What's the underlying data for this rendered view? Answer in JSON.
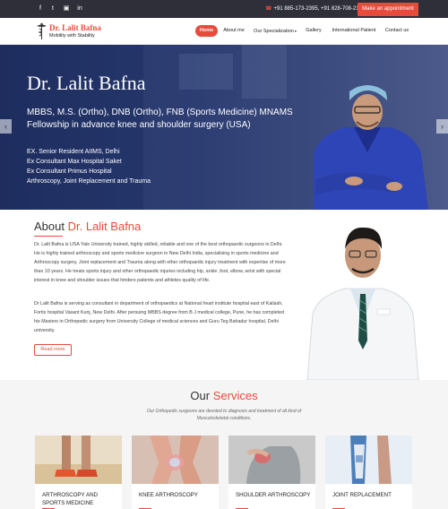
{
  "topbar": {
    "social": [
      "facebook-icon",
      "twitter-icon",
      "instagram-icon",
      "linkedin-icon"
    ],
    "phone": "+91 885-173-2395, +91 828-708-2133",
    "appointment_button": "Make an appointment"
  },
  "brand": {
    "name": "Dr. Lalit Bafna",
    "tagline": "Mobility with Stability"
  },
  "nav": {
    "items": [
      "Home",
      "About me",
      "Our Specialization",
      "Gallery",
      "International Patient",
      "Contact us"
    ],
    "active": "Home"
  },
  "hero": {
    "title": "Dr. Lalit Bafna",
    "subtitle_line1": "MBBS, M.S. (Ortho), DNB (Ortho), FNB (Sports Medicine) MNAMS",
    "subtitle_line2": "Fellowship in advance knee and shoulder surgery (USA)",
    "list": [
      "EX. Senior Resident AIIMS, Delhi",
      "Ex Consultant Max Hospital Saket",
      "Ex Consultant Primus Hospital",
      "Arthroscopy, Joint Replacement and Trauma"
    ]
  },
  "about": {
    "heading_prefix": "About",
    "heading_name": "Dr. Lalit Bafna",
    "para1": "Dr. Lalit Bafna is USA Yale University trained, highly skilled, reliable and one of the best orthopaedic surgeons in Delhi. He is highly trained arthroscopy and sports medicine surgeon in New Delhi India, specialising in sports medicine and Arthroscopy surgery, Joint replacement and Trauma along with other orthopaedic injury treatment with expertise of more than 10 years. He treats sports injury and other orthopaedic injuries including hip, ankle ,foot, elbow, wrist with special interest in knee and shoulder issues that hinders patients and athletes quality of life.",
    "para2": "Dr Lalit Bafna is serving as consultant in department of orthopaedics at National heart institute hospital east of Kailash, Fortis hospital Vasant Kunj, New Delhi. After persuing MBBS degree from B J medical college, Pune, he has completed his Masters in Orthopedic surgery from University College of medical sciences and Guru Teg Bahadur hospital, Delhi university.",
    "read_more": "Read more"
  },
  "services": {
    "heading_prefix": "Our",
    "heading_accent": "Services",
    "description": "Our Orthopedic surgeons are devoted to diagnosis and treatment of all kind of Musculoskeletal conditions.",
    "cards": [
      {
        "title": "ARTHROSCOPY AND SPORTS MEDICINE"
      },
      {
        "title": "KNEE ARTHROSCOPY"
      },
      {
        "title": "SHOULDER ARTHROSCOPY"
      },
      {
        "title": "JOINT REPLACEMENT"
      }
    ]
  },
  "colors": {
    "accent": "#e84b3c",
    "topbar": "#2f2f3a",
    "hero_bg": "#26386e"
  }
}
